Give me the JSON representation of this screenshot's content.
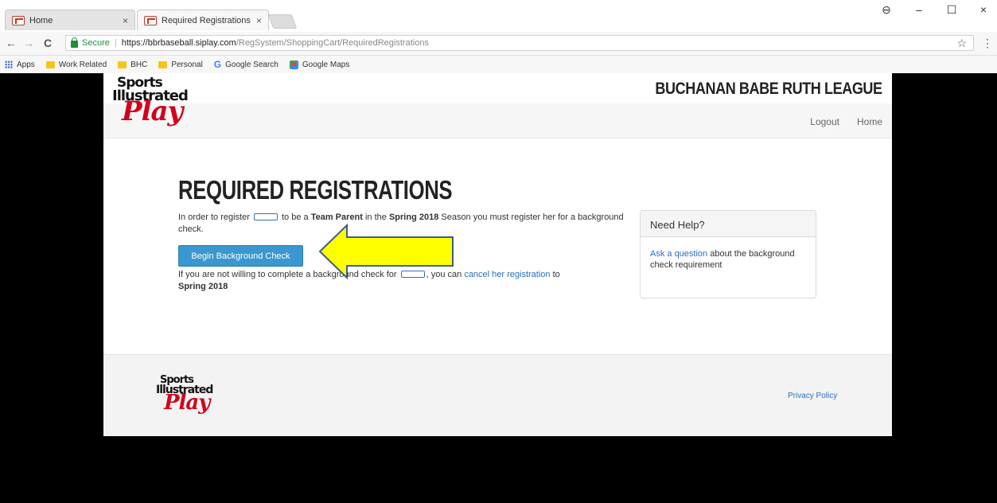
{
  "browser": {
    "tabs": [
      {
        "label": "Home",
        "close": "×"
      },
      {
        "label": "Required Registrations",
        "close": "×"
      }
    ],
    "window_controls": {
      "account": "⊖",
      "minimize": "–",
      "maximize": "☐",
      "close": "×"
    },
    "nav": {
      "back": "←",
      "forward": "→",
      "reload": "C"
    },
    "address": {
      "secure_label": "Secure",
      "separator": "|",
      "host": "https://bbrbaseball.siplay.com",
      "path": "/RegSystem/ShoppingCart/RequiredRegistrations"
    },
    "star": "☆",
    "menu": "⋮",
    "bookmarks": [
      "Apps",
      "Work Related",
      "BHC",
      "Personal",
      "Google Search",
      "Google Maps"
    ],
    "bookmark_icons": [
      "apps-icon",
      "folder-icon",
      "folder-icon",
      "folder-icon",
      "google-icon",
      "maps-icon"
    ]
  },
  "header": {
    "logo": {
      "line1": "Sports",
      "line2": "Illustrated",
      "line3": "Play"
    },
    "league": "BUCHANAN BABE RUTH LEAGUE",
    "nav": [
      "Logout",
      "Home"
    ]
  },
  "main": {
    "title": "REQUIRED REGISTRATIONS",
    "intro": {
      "p1": "In order to register ",
      "p2": " to be a ",
      "role": "Team Parent",
      "p3": " in the ",
      "season": "Spring 2018",
      "p4": " Season you must register her for a background check."
    },
    "button_label": "Begin Background Check",
    "cancel": {
      "p1": "If you are not willing to complete a background check for ",
      "p2": ", you can ",
      "link": "cancel her registration",
      "p3": " to ",
      "season": "Spring 2018"
    }
  },
  "help": {
    "title": "Need Help?",
    "link": "Ask a question",
    "text": " about the background check requirement"
  },
  "footer": {
    "logo": {
      "line1": "Sports",
      "line2": "Illustrated",
      "line3": "Play"
    },
    "privacy": "Privacy Policy"
  },
  "colors": {
    "button": "#3a97cf",
    "link": "#2a6ebb",
    "arrow_fill": "#ffff00",
    "arrow_stroke": "#3b5e8c",
    "logo_red": "#d0021b"
  }
}
